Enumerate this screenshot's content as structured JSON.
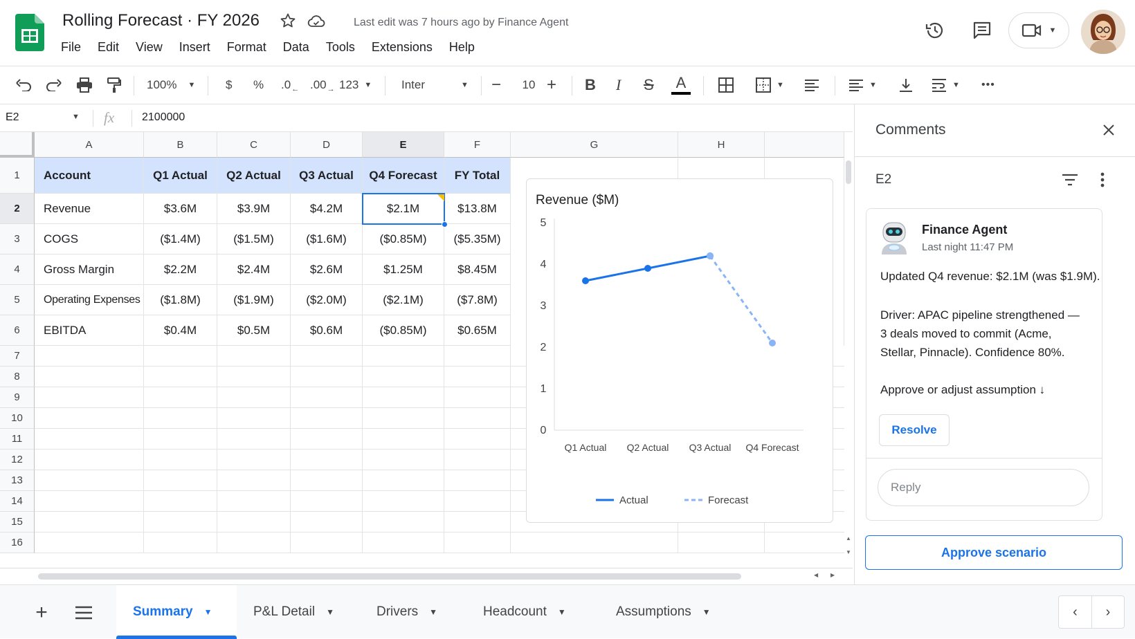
{
  "header": {
    "title": "Rolling Forecast · FY 2026",
    "last_edit": "Last edit was 7 hours ago by Finance Agent",
    "menu": [
      "File",
      "Edit",
      "View",
      "Insert",
      "Format",
      "Data",
      "Tools",
      "Extensions",
      "Help"
    ]
  },
  "toolbar": {
    "zoom": "100%",
    "currency": "$",
    "percent": "%",
    "dec_decrease": ".0",
    "dec_increase": ".00",
    "number_format": "123",
    "font": "Inter",
    "font_size": "10",
    "bold": "B",
    "italic": "I",
    "strike": "S",
    "text_color": "A",
    "more": "•••"
  },
  "formula_bar": {
    "cell_ref": "E2",
    "fx": "fx",
    "value": "2100000"
  },
  "grid": {
    "columns": [
      "A",
      "B",
      "C",
      "D",
      "E",
      "F",
      "G",
      "H"
    ],
    "rows": [
      "1",
      "2",
      "3",
      "4",
      "5",
      "6",
      "7",
      "8",
      "9",
      "10",
      "11",
      "12",
      "13",
      "14",
      "15",
      "16"
    ],
    "header_row": [
      "Account",
      "Q1 Actual",
      "Q2 Actual",
      "Q3 Actual",
      "Q4 Forecast",
      "FY Total"
    ],
    "data_rows": [
      [
        "Revenue",
        "$3.6M",
        "$3.9M",
        "$4.2M",
        "$2.1M",
        "$13.8M"
      ],
      [
        "COGS",
        "($1.4M)",
        "($1.5M)",
        "($1.6M)",
        "($0.85M)",
        "($5.35M)"
      ],
      [
        "Gross Margin",
        "$2.2M",
        "$2.4M",
        "$2.6M",
        "$1.25M",
        "$8.45M"
      ],
      [
        "Operating Expenses",
        "($1.8M)",
        "($1.9M)",
        "($2.0M)",
        "($2.1M)",
        "($7.8M)"
      ],
      [
        "EBITDA",
        "$0.4M",
        "$0.5M",
        "$0.6M",
        "($0.85M)",
        "$0.65M"
      ]
    ],
    "selected_cell": "E2"
  },
  "chart_data": {
    "type": "line",
    "title": "Revenue ($M)",
    "categories": [
      "Q1 Actual",
      "Q2 Actual",
      "Q3 Actual",
      "Q4 Forecast"
    ],
    "yticks": [
      "0",
      "1",
      "2",
      "3",
      "4",
      "5"
    ],
    "ylim": [
      0,
      5
    ],
    "series": [
      {
        "name": "Actual",
        "values": [
          3.6,
          3.9,
          4.2,
          null
        ],
        "color": "#1a73e8",
        "style": "solid"
      },
      {
        "name": "Forecast",
        "values": [
          null,
          null,
          4.2,
          2.1
        ],
        "color": "#8ab4f8",
        "style": "dashed"
      }
    ],
    "legend": "bottom"
  },
  "comments": {
    "title": "Comments",
    "cell_ref": "E2",
    "author": "Finance Agent",
    "time": "Last night 11:47 PM",
    "para1": "Updated Q4 revenue: $2.1M (was $1.9M).",
    "para2_l1": "Driver: APAC pipeline strengthened —",
    "para2_l2": "3 deals moved to commit (Acme,",
    "para2_l3": "Stellar, Pinnacle). Confidence 80%.",
    "para3": "Approve or adjust assumption ↓",
    "resolve": "Resolve",
    "reply_placeholder": "Reply",
    "approve": "Approve scenario"
  },
  "tabs": [
    "Summary",
    "P&L Detail",
    "Drivers",
    "Headcount",
    "Assumptions"
  ],
  "active_tab": "Summary",
  "colors": {
    "accent": "#1a73e8",
    "header_fill": "#d3e3fd",
    "sheets_green": "#0f9d58"
  }
}
